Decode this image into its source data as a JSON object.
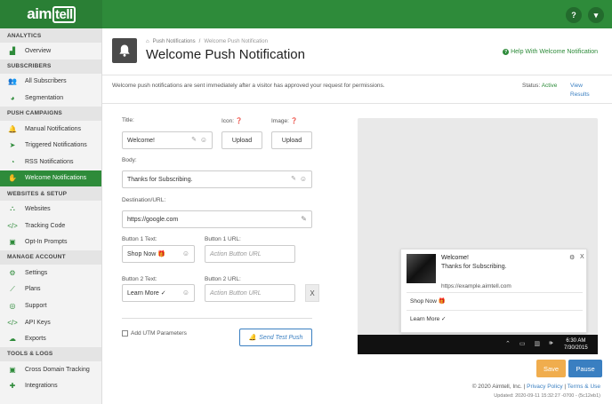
{
  "header": {
    "logo_text": "aim",
    "logo_text_ll": "tell",
    "help_icon": "question-circle-icon",
    "menu_icon": "caret-down-icon"
  },
  "sidebar": {
    "sections": [
      {
        "title": "ANALYTICS",
        "items": [
          {
            "label": "Overview",
            "icon": "chart-icon"
          }
        ]
      },
      {
        "title": "SUBSCRIBERS",
        "items": [
          {
            "label": "All Subscribers",
            "icon": "users-icon"
          },
          {
            "label": "Segmentation",
            "icon": "pie-icon"
          }
        ]
      },
      {
        "title": "PUSH CAMPAIGNS",
        "items": [
          {
            "label": "Manual Notifications",
            "icon": "bell-icon"
          },
          {
            "label": "Triggered Notifications",
            "icon": "paper-plane-icon"
          },
          {
            "label": "RSS Notifications",
            "icon": "rss-icon"
          },
          {
            "label": "Welcome Notifications",
            "icon": "hand-icon",
            "active": true
          }
        ]
      },
      {
        "title": "WEBSITES & SETUP",
        "items": [
          {
            "label": "Websites",
            "icon": "sitemap-icon"
          },
          {
            "label": "Tracking Code",
            "icon": "code-icon"
          },
          {
            "label": "Opt-In Prompts",
            "icon": "window-icon"
          }
        ]
      },
      {
        "title": "MANAGE ACCOUNT",
        "items": [
          {
            "label": "Settings",
            "icon": "cogs-icon"
          },
          {
            "label": "Plans",
            "icon": "line-chart-icon"
          },
          {
            "label": "Support",
            "icon": "life-ring-icon"
          },
          {
            "label": "API Keys",
            "icon": "code-icon"
          },
          {
            "label": "Exports",
            "icon": "cloud-download-icon"
          }
        ]
      },
      {
        "title": "TOOLS & LOGS",
        "items": [
          {
            "label": "Cross Domain Tracking",
            "icon": "window-icon"
          },
          {
            "label": "Integrations",
            "icon": "puzzle-icon"
          }
        ]
      }
    ]
  },
  "breadcrumb": {
    "home_icon": "home-icon",
    "parent": "Push Notifications",
    "separator": "/",
    "current": "Welcome Push Notification"
  },
  "page": {
    "title": "Welcome Push Notification",
    "help_link": "Help With Welcome Notification",
    "info_text": "Welcome push notifications are sent immediately after a visitor has approved your request for permissions.",
    "status_label": "Status:",
    "status_value": "Active",
    "view_results": "View Results"
  },
  "form": {
    "title_label": "Title:",
    "title_value": "Welcome!",
    "icon_label": "Icon:",
    "icon_button": "Upload",
    "image_label": "Image:",
    "image_button": "Upload",
    "body_label": "Body:",
    "body_value": "Thanks for Subscribing.",
    "url_label": "Destination/URL:",
    "url_value": "https://google.com",
    "button1_text_label": "Button 1 Text:",
    "button1_text_value": "Shop Now 🎁",
    "button1_url_label": "Button 1 URL:",
    "button1_url_placeholder": "Action Button URL",
    "button2_text_label": "Button 2 Text:",
    "button2_text_value": "Learn More ✓",
    "button2_url_label": "Button 2 URL:",
    "button2_url_placeholder": "Action Button URL",
    "remove_label": "X",
    "utm_label": "Add UTM Parameters",
    "send_test_label": "Send Test Push"
  },
  "preview": {
    "title": "Welcome!",
    "body": "Thanks for Subscribing.",
    "url": "https://example.aimtell.com",
    "action1": "Shop Now 🎁",
    "action2": "Learn More ✓",
    "close": "X",
    "time": "6:30 AM",
    "date": "7/30/2015"
  },
  "actions": {
    "save": "Save",
    "pause": "Pause"
  },
  "footer": {
    "copyright": "© 2020 Aimtell, Inc. |",
    "privacy": "Privacy Policy",
    "sep": "|",
    "terms": "Terms & Use",
    "updated": "Updated: 2020-09-11 15:32:27 -0700 - (5c12eb1)"
  },
  "colors": {
    "brand_green": "#2e8b3a",
    "link_blue": "#3a7fc1",
    "save_orange": "#f0ad4e"
  }
}
